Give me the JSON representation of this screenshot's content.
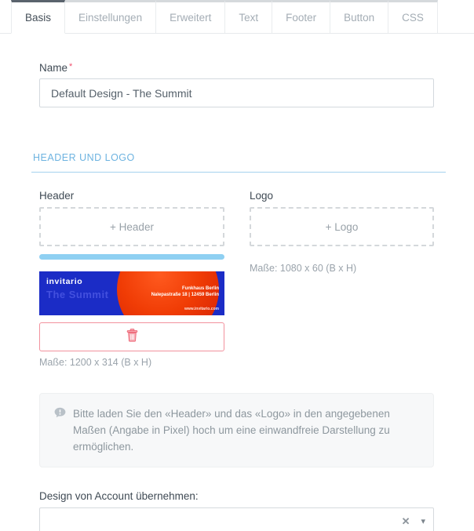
{
  "tabs": [
    {
      "label": "Basis",
      "active": true
    },
    {
      "label": "Einstellungen",
      "active": false
    },
    {
      "label": "Erweitert",
      "active": false
    },
    {
      "label": "Text",
      "active": false
    },
    {
      "label": "Footer",
      "active": false
    },
    {
      "label": "Button",
      "active": false
    },
    {
      "label": "CSS",
      "active": false
    }
  ],
  "form": {
    "name": {
      "label": "Name",
      "required_marker": "*",
      "value": "Default Design - The Summit"
    },
    "section_title": "HEADER UND LOGO",
    "header_upload": {
      "label": "Header",
      "button": "+ Header",
      "dimensions": "Maße: 1200 x 314 (B x H)"
    },
    "logo_upload": {
      "label": "Logo",
      "button": "+ Logo",
      "dimensions": "Maße: 1080 x 60 (B x H)"
    },
    "banner_preview": {
      "brand": "invitario",
      "title": "The Summit",
      "address_line1": "Funkhaus Berlin",
      "address_line2": "Nalepastraße 18 | 12459 Berlin",
      "website": "www.invitario.com"
    },
    "info_note": "Bitte laden Sie den «Header» und das «Logo» in den angegebenen Maßen (Angabe in Pixel) hoch um eine einwandfreie Darstellung zu ermöglichen.",
    "account_design": {
      "label": "Design von Account übernehmen:",
      "value": "",
      "clear_glyph": "✕",
      "caret_glyph": "▾"
    }
  },
  "icons": {
    "delete": "trash-icon",
    "note": "speech-bubble-icon",
    "clear": "clear-x-icon",
    "dropdown": "chevron-down-icon"
  },
  "colors": {
    "accent_blue": "#6db3e0",
    "progress_blue": "#8fd0f2",
    "banner_blue": "#1b2cc6",
    "banner_circle_red": "#e8320a",
    "danger_red": "#ee6575",
    "required_red": "#f0506e",
    "tab_active_accent": "#5a636d"
  }
}
